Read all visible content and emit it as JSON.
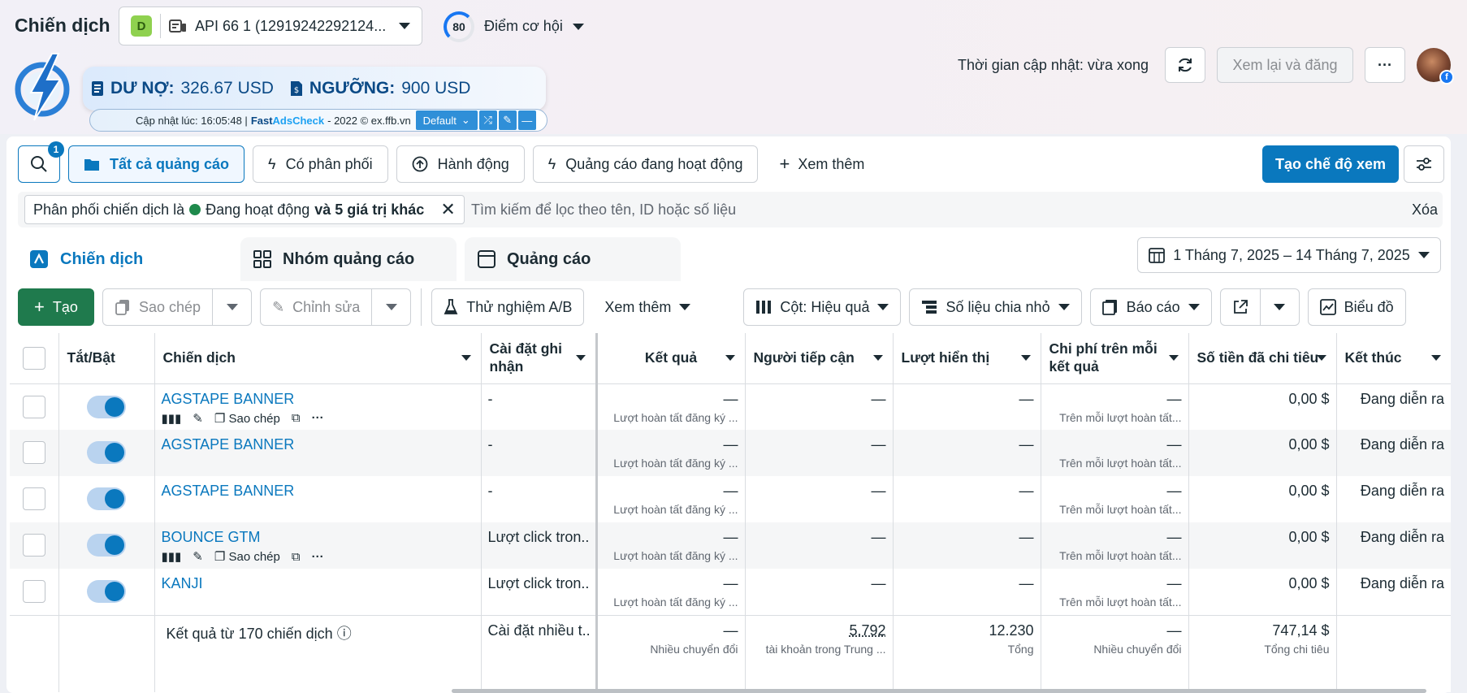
{
  "header": {
    "title": "Chiến dịch",
    "account_initial": "D",
    "account_name": "API 66 1 (12919242292124...",
    "score": "80",
    "opportunity_label": "Điểm cơ hội",
    "update_time": "Thời gian cập nhật: vừa xong",
    "review_publish": "Xem lại và đăng",
    "more": "···"
  },
  "ext": {
    "debt_label": "DƯ NỢ:",
    "debt_value": "326.67 USD",
    "threshold_label": "NGƯỠNG:",
    "threshold_value": "900 USD",
    "updated": "Cập nhật lúc: 16:05:48 |",
    "fast": "Fast",
    "adscheck": "AdsCheck",
    "copyright": "- 2022 © ex.ffb.vn",
    "profile": "Default"
  },
  "filters": {
    "search_badge": "1",
    "all_ads": "Tất cả quảng cáo",
    "has_delivery": "Có phân phối",
    "actions": "Hành động",
    "active_ads": "Quảng cáo đang hoạt động",
    "see_more": "Xem thêm",
    "create_view": "Tạo chế độ xem",
    "chip_prefix": "Phân phối chiến dịch là",
    "chip_value": "Đang hoạt động",
    "chip_suffix": "và 5 giá trị khác",
    "search_placeholder": "Tìm kiếm để lọc theo tên, ID hoặc số liệu",
    "clear": "Xóa"
  },
  "tabs": {
    "campaigns": "Chiến dịch",
    "ad_sets": "Nhóm quảng cáo",
    "ads": "Quảng cáo",
    "date_range": "1 Tháng 7, 2025 – 14 Tháng 7, 2025"
  },
  "toolbar": {
    "create": "Tạo",
    "copy": "Sao chép",
    "edit": "Chỉnh sửa",
    "ab_test": "Thử nghiệm A/B",
    "more": "Xem thêm",
    "columns": "Cột: Hiệu quả",
    "breakdown": "Số liệu chia nhỏ",
    "reports": "Báo cáo",
    "chart": "Biểu đồ"
  },
  "table": {
    "headers": {
      "toggle": "Tắt/Bật",
      "campaign": "Chiến dịch",
      "attribution": "Cài đặt ghi nhận",
      "results": "Kết quả",
      "reach": "Người tiếp cận",
      "impressions": "Lượt hiển thị",
      "cost_per_result": "Chi phí trên mỗi kết quả",
      "amount_spent": "Số tiền đã chi tiêu",
      "ends": "Kết thúc"
    },
    "row_actions": {
      "copy": "Sao chép"
    },
    "rows": [
      {
        "name": "AGSTAPE BANNER",
        "setting": "-",
        "results": "—",
        "results_sub": "Lượt hoàn tất đăng ký ...",
        "reach": "—",
        "impressions": "—",
        "cpr": "—",
        "cpr_sub": "Trên mỗi lượt hoàn tất...",
        "spent": "0,00 $",
        "ends": "Đang diễn ra"
      },
      {
        "name": "AGSTAPE BANNER",
        "setting": "-",
        "results": "—",
        "results_sub": "Lượt hoàn tất đăng ký ...",
        "reach": "—",
        "impressions": "—",
        "cpr": "—",
        "cpr_sub": "Trên mỗi lượt hoàn tất...",
        "spent": "0,00 $",
        "ends": "Đang diễn ra"
      },
      {
        "name": "AGSTAPE BANNER",
        "setting": "-",
        "results": "—",
        "results_sub": "Lượt hoàn tất đăng ký ...",
        "reach": "—",
        "impressions": "—",
        "cpr": "—",
        "cpr_sub": "Trên mỗi lượt hoàn tất...",
        "spent": "0,00 $",
        "ends": "Đang diễn ra"
      },
      {
        "name": "BOUNCE GTM",
        "setting": "Lượt click tron...",
        "results": "—",
        "results_sub": "Lượt hoàn tất đăng ký ...",
        "reach": "—",
        "impressions": "—",
        "cpr": "—",
        "cpr_sub": "Trên mỗi lượt hoàn tất...",
        "spent": "0,00 $",
        "ends": "Đang diễn ra"
      },
      {
        "name": "KANJI",
        "setting": "Lượt click tron...",
        "results": "—",
        "results_sub": "Lượt hoàn tất đăng ký ...",
        "reach": "—",
        "impressions": "—",
        "cpr": "—",
        "cpr_sub": "Trên mỗi lượt hoàn tất...",
        "spent": "0,00 $",
        "ends": "Đang diễn ra"
      }
    ],
    "summary": {
      "label": "Kết quả từ 170 chiến dịch",
      "setting": "Cài đặt nhiều t...",
      "results": "—",
      "results_sub": "Nhiều chuyển đổi",
      "reach": "5.792",
      "reach_sub": "tài khoản trong Trung ...",
      "impressions": "12.230",
      "impressions_sub": "Tổng",
      "cpr": "—",
      "cpr_sub": "Nhiều chuyển đổi",
      "spent": "747,14 $",
      "spent_sub": "Tổng chi tiêu"
    }
  }
}
